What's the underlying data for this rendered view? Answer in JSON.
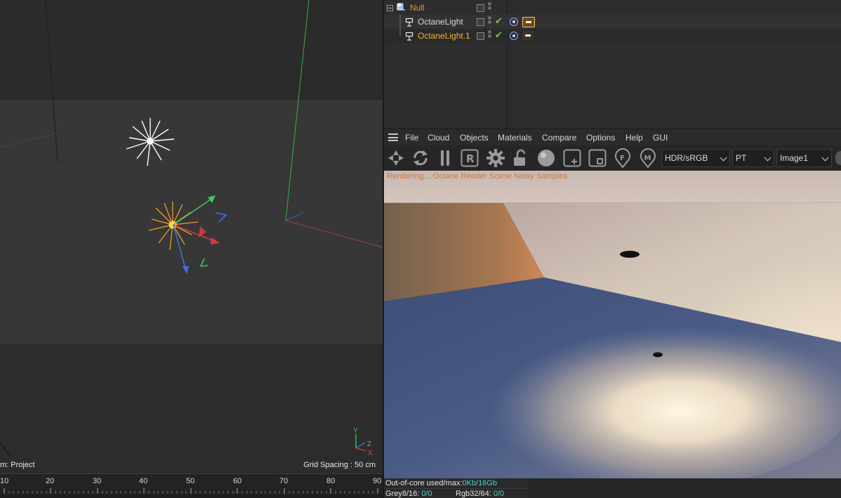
{
  "viewport": {
    "projection_label": "m: Project",
    "grid_spacing_label": "Grid Spacing : 50 cm",
    "axis_labels": {
      "y": "Y",
      "z": "Z",
      "x": "X"
    },
    "timeline_ticks": [
      "10",
      "20",
      "30",
      "40",
      "50",
      "60",
      "70",
      "80",
      "90"
    ]
  },
  "object_manager": {
    "rows": [
      {
        "name": "Null",
        "icon": "null-object-icon",
        "color": "#e29a2d",
        "selected": false
      },
      {
        "name": "OctaneLight",
        "icon": "octane-light-icon",
        "color": "#d8d8d8",
        "selected": false
      },
      {
        "name": "OctaneLight.1",
        "icon": "octane-light-icon",
        "color": "#f2b638",
        "selected": true
      }
    ]
  },
  "octane_menu": {
    "items": [
      "File",
      "Cloud",
      "Objects",
      "Materials",
      "Compare",
      "Options",
      "Help",
      "GUI"
    ]
  },
  "octane_toolbar": {
    "buttons": [
      "send-scene-icon",
      "restart-render-icon",
      "pause-icon",
      "render-region-icon",
      "settings-gear-icon",
      "unlock-icon",
      "material-ball-icon",
      "add-region-icon",
      "focus-region-icon",
      "f-pin-icon",
      "m-pin-icon"
    ],
    "color_space": "HDR/sRGB",
    "kernel": "PT",
    "output": "Image1"
  },
  "render_view": {
    "status_text": "Rendering...  Octane Render  Scene  Noisy  Samples"
  },
  "status": {
    "out_of_core_label": "Out-of-core used/max:",
    "out_of_core_value": "0Kb/16Gb",
    "grey_label": "Grey8/16:",
    "grey_value": "0/0",
    "rgb_label": "Rgb32/64:",
    "rgb_value": "0/0"
  },
  "colors": {
    "selected_text": "#f2b638",
    "accent_teal": "#4fd2c8",
    "render_status_orange": "#d86a20"
  }
}
